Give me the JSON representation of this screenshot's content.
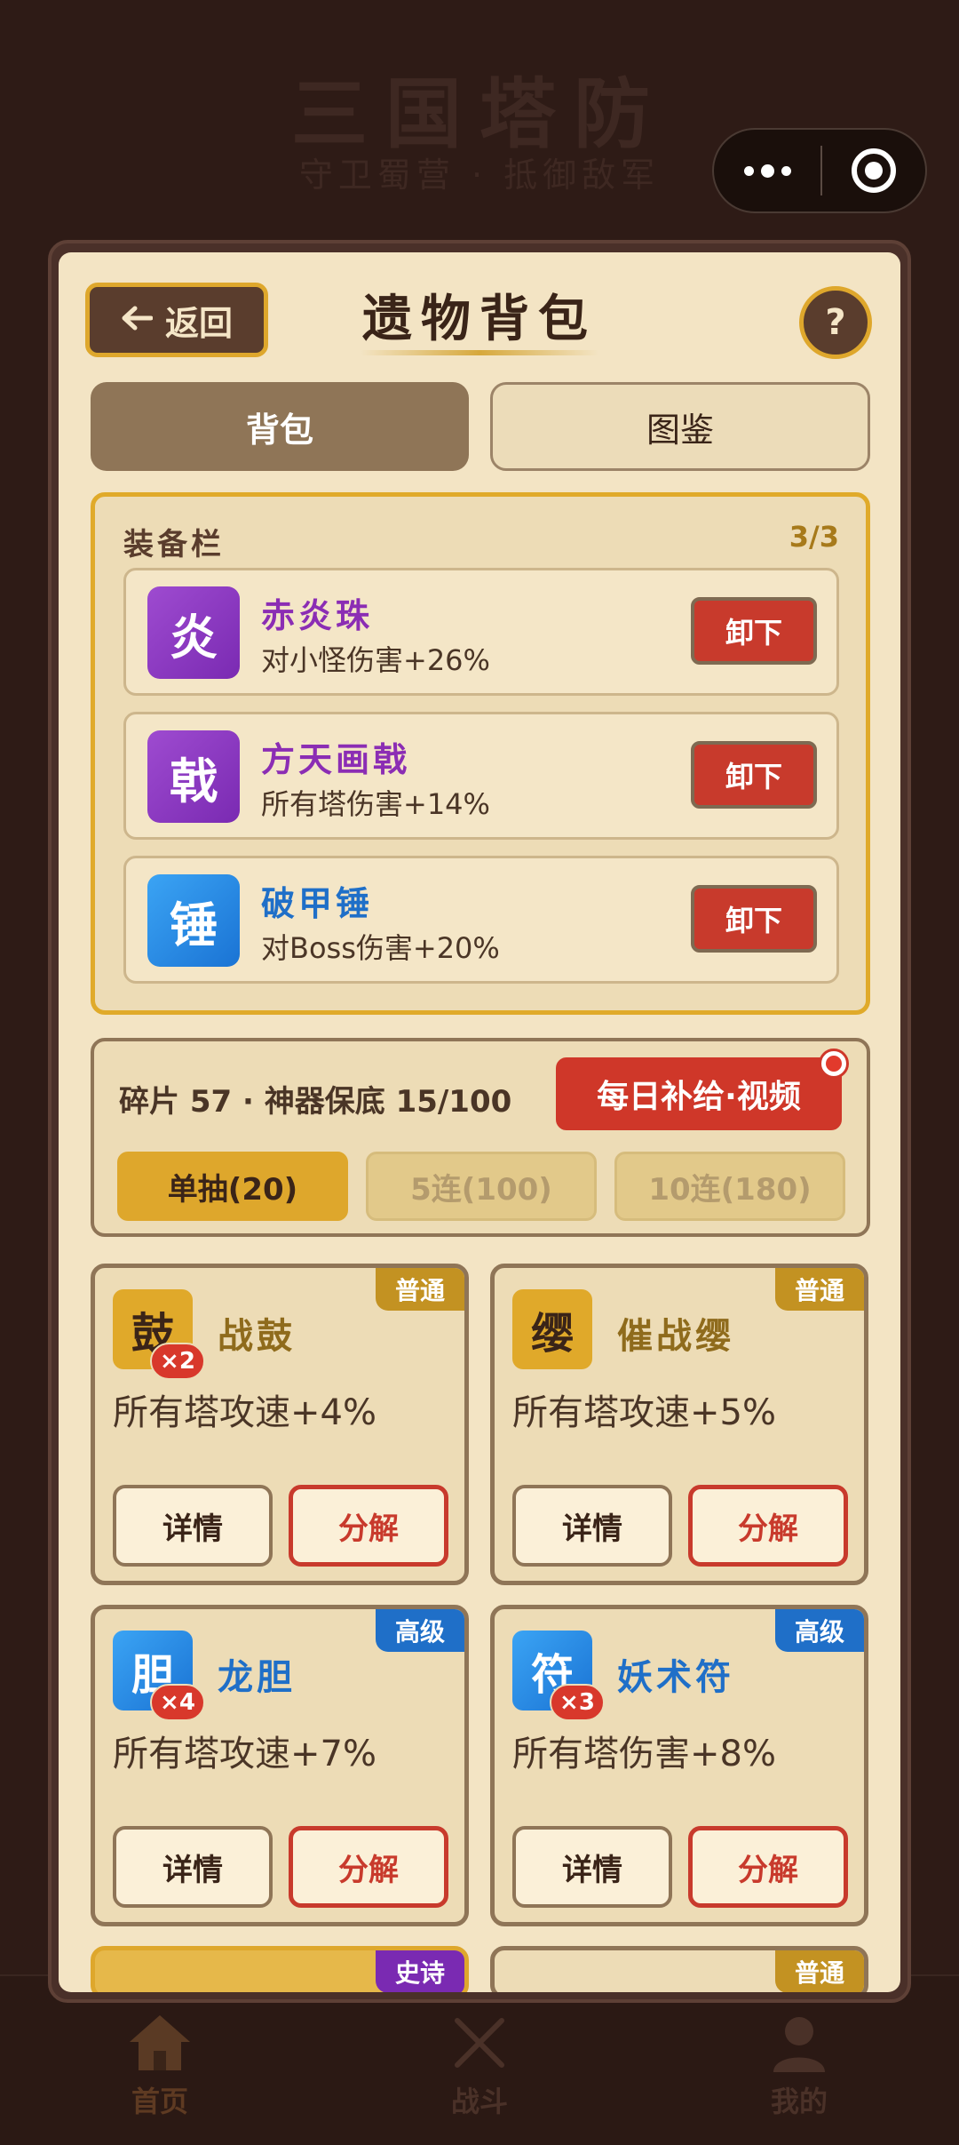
{
  "background": {
    "title": "三国塔防",
    "subtitle": "守卫蜀营 · 抵御敌军"
  },
  "header": {
    "back_label": "返回",
    "title": "遗物背包",
    "help_label": "?"
  },
  "tabs": [
    {
      "label": "背包",
      "active": true
    },
    {
      "label": "图鉴",
      "active": false
    }
  ],
  "equip_slots": {
    "title": "装备栏",
    "count": "3/3",
    "items": [
      {
        "icon_char": "炎",
        "name": "赤炎珠",
        "desc": "对小怪伤害+26%",
        "rarity_color": "#8b2db4",
        "action": "卸下"
      },
      {
        "icon_char": "戟",
        "name": "方天画戟",
        "desc": "所有塔伤害+14%",
        "rarity_color": "#8b2db4",
        "action": "卸下"
      },
      {
        "icon_char": "锤",
        "name": "破甲锤",
        "desc": "对Boss伤害+20%",
        "rarity_color": "#1f6fc8",
        "action": "卸下"
      }
    ]
  },
  "gacha": {
    "info": "碎片 57 · 神器保底 15/100",
    "daily_label": "每日补给·视频",
    "draws": [
      {
        "label": "单抽(20)",
        "enabled": true
      },
      {
        "label": "5连(100)",
        "enabled": false
      },
      {
        "label": "10连(180)",
        "enabled": false
      }
    ]
  },
  "relics": [
    {
      "icon_char": "鼓",
      "count": "×2",
      "name": "战鼓",
      "desc": "所有塔攻速+4%",
      "rarity": "普通",
      "detail_label": "详情",
      "decompose_label": "分解"
    },
    {
      "icon_char": "缨",
      "count": "",
      "name": "催战缨",
      "desc": "所有塔攻速+5%",
      "rarity": "普通",
      "detail_label": "详情",
      "decompose_label": "分解"
    },
    {
      "icon_char": "胆",
      "count": "×4",
      "name": "龙胆",
      "desc": "所有塔攻速+7%",
      "rarity": "高级",
      "detail_label": "详情",
      "decompose_label": "分解"
    },
    {
      "icon_char": "符",
      "count": "×3",
      "name": "妖术符",
      "desc": "所有塔伤害+8%",
      "rarity": "高级",
      "detail_label": "详情",
      "decompose_label": "分解"
    }
  ],
  "relics_partial": [
    {
      "rarity": "史诗"
    },
    {
      "rarity": "普通"
    }
  ],
  "bottom_nav": [
    {
      "icon": "home-icon",
      "label": "首页",
      "active": true
    },
    {
      "icon": "swords-icon",
      "label": "战斗",
      "active": false
    },
    {
      "icon": "user-icon",
      "label": "我的",
      "active": false
    }
  ],
  "colors": {
    "accent_gold": "#dea72c",
    "danger_red": "#c83a2c",
    "epic_purple": "#8b2db4",
    "rare_blue": "#1f6fc8",
    "common_gold": "#c39222"
  }
}
